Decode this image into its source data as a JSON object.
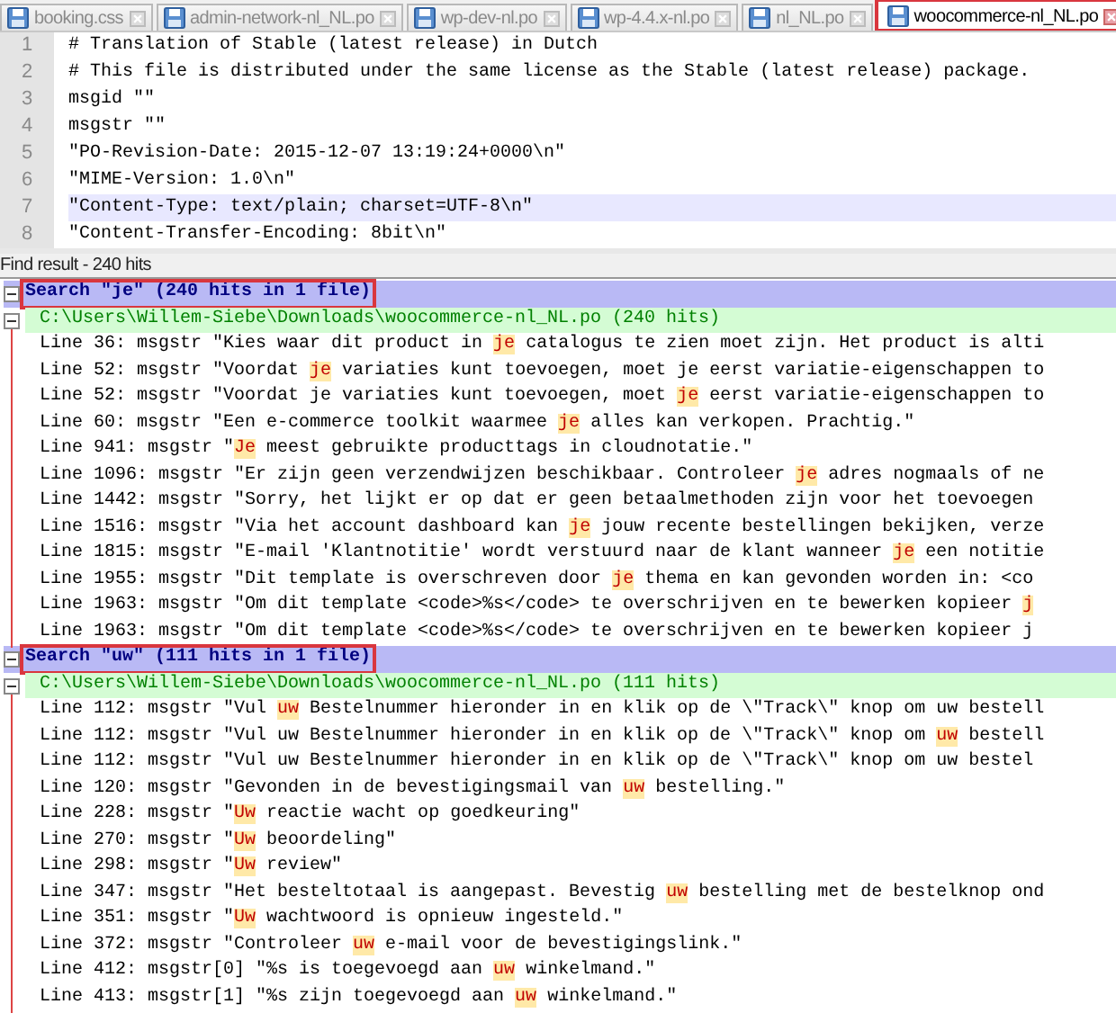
{
  "tabs": [
    {
      "label": "booking.css",
      "selected": false,
      "callout": false
    },
    {
      "label": "admin-network-nl_NL.po",
      "selected": false,
      "callout": false
    },
    {
      "label": "wp-dev-nl.po",
      "selected": false,
      "callout": false
    },
    {
      "label": "wp-4.4.x-nl.po",
      "selected": false,
      "callout": false
    },
    {
      "label": "nl_NL.po",
      "selected": false,
      "callout": false
    },
    {
      "label": "woocommerce-nl_NL.po",
      "selected": true,
      "callout": true
    }
  ],
  "editor": {
    "lines": [
      {
        "number": "1",
        "text": "# Translation of Stable (latest release) in Dutch",
        "current": false
      },
      {
        "number": "2",
        "text": "# This file is distributed under the same license as the Stable (latest release) package.",
        "current": false
      },
      {
        "number": "3",
        "text": "msgid \"\"",
        "current": false
      },
      {
        "number": "4",
        "text": "msgstr \"\"",
        "current": false
      },
      {
        "number": "5",
        "text": "\"PO-Revision-Date: 2015-12-07 13:19:24+0000\\n\"",
        "current": false
      },
      {
        "number": "6",
        "text": "\"MIME-Version: 1.0\\n\"",
        "current": false
      },
      {
        "number": "7",
        "text": "\"Content-Type: text/plain; charset=UTF-8\\n\"",
        "current": true
      },
      {
        "number": "8",
        "text": "\"Content-Transfer-Encoding: 8bit\\n\"",
        "current": false
      }
    ]
  },
  "find_result": {
    "title": "Find result - 240 hits",
    "searches": [
      {
        "header": "Search \"je\" (240 hits in 1 file)",
        "callout": true,
        "file": "C:\\Users\\Willem-Siebe\\Downloads\\woocommerce-nl_NL.po (240 hits)",
        "hits": [
          {
            "before": "Line 36: msgstr \"Kies waar dit product in ",
            "match": "je",
            "after": " catalogus te zien moet zijn. Het product is alti"
          },
          {
            "before": "Line 52: msgstr \"Voordat ",
            "match": "je",
            "after": " variaties kunt toevoegen, moet je eerst variatie-eigenschappen to"
          },
          {
            "before": "Line 52: msgstr \"Voordat je variaties kunt toevoegen, moet ",
            "match": "je",
            "after": " eerst variatie-eigenschappen to"
          },
          {
            "before": "Line 60: msgstr \"Een e-commerce toolkit waarmee ",
            "match": "je",
            "after": " alles kan verkopen. Prachtig.\""
          },
          {
            "before": "Line 941: msgstr \"",
            "match": "Je",
            "after": " meest gebruikte producttags in cloudnotatie.\""
          },
          {
            "before": "Line 1096: msgstr \"Er zijn geen verzendwijzen beschikbaar. Controleer ",
            "match": "je",
            "after": " adres nogmaals of ne"
          },
          {
            "before": "Line 1442: msgstr \"Sorry, het lijkt er op dat er geen betaalmethoden zijn voor het toevoegen"
          },
          {
            "before": "Line 1516: msgstr \"Via het account dashboard kan ",
            "match": "je",
            "after": " jouw recente bestellingen bekijken, verze"
          },
          {
            "before": "Line 1815: msgstr \"E-mail 'Klantnotitie' wordt verstuurd naar de klant wanneer ",
            "match": "je",
            "after": " een notitie"
          },
          {
            "before": "Line 1955: msgstr \"Dit template is overschreven door ",
            "match": "je",
            "after": " thema en kan gevonden worden in: <co"
          },
          {
            "before": "Line 1963: msgstr \"Om dit template <code>%s</code> te overschrijven en te bewerken kopieer ",
            "match": "j"
          },
          {
            "before": "Line 1963: msgstr \"Om dit template <code>%s</code> te overschrijven en te bewerken kopieer j"
          }
        ]
      },
      {
        "header": "Search \"uw\" (111 hits in 1 file)",
        "callout": true,
        "file": "C:\\Users\\Willem-Siebe\\Downloads\\woocommerce-nl_NL.po (111 hits)",
        "hits": [
          {
            "before": "Line 112: msgstr \"Vul ",
            "match": "uw",
            "after": " Bestelnummer hieronder in en klik op de \\\"Track\\\" knop om uw bestell"
          },
          {
            "before": "Line 112: msgstr \"Vul uw Bestelnummer hieronder in en klik op de \\\"Track\\\" knop om ",
            "match": "uw",
            "after": " bestell"
          },
          {
            "before": "Line 112: msgstr \"Vul uw Bestelnummer hieronder in en klik op de \\\"Track\\\" knop om uw bestel"
          },
          {
            "before": "Line 120: msgstr \"Gevonden in de bevestigingsmail van ",
            "match": "uw",
            "after": " bestelling.\""
          },
          {
            "before": "Line 228: msgstr \"",
            "match": "Uw",
            "after": " reactie wacht op goedkeuring\""
          },
          {
            "before": "Line 270: msgstr \"",
            "match": "Uw",
            "after": " beoordeling\""
          },
          {
            "before": "Line 298: msgstr \"",
            "match": "Uw",
            "after": " review\""
          },
          {
            "before": "Line 347: msgstr \"Het besteltotaal is aangepast. Bevestig ",
            "match": "uw",
            "after": " bestelling met de bestelknop ond"
          },
          {
            "before": "Line 351: msgstr \"",
            "match": "Uw",
            "after": " wachtwoord is opnieuw ingesteld.\""
          },
          {
            "before": "Line 372: msgstr \"Controleer ",
            "match": "uw",
            "after": " e-mail voor de bevestigingslink.\""
          },
          {
            "before": "Line 412: msgstr[0] \"%s is toegevoegd aan ",
            "match": "uw",
            "after": " winkelmand.\""
          },
          {
            "before": "Line 413: msgstr[1] \"%s zijn toegevoegd aan ",
            "match": "uw",
            "after": " winkelmand.\""
          }
        ]
      }
    ]
  }
}
